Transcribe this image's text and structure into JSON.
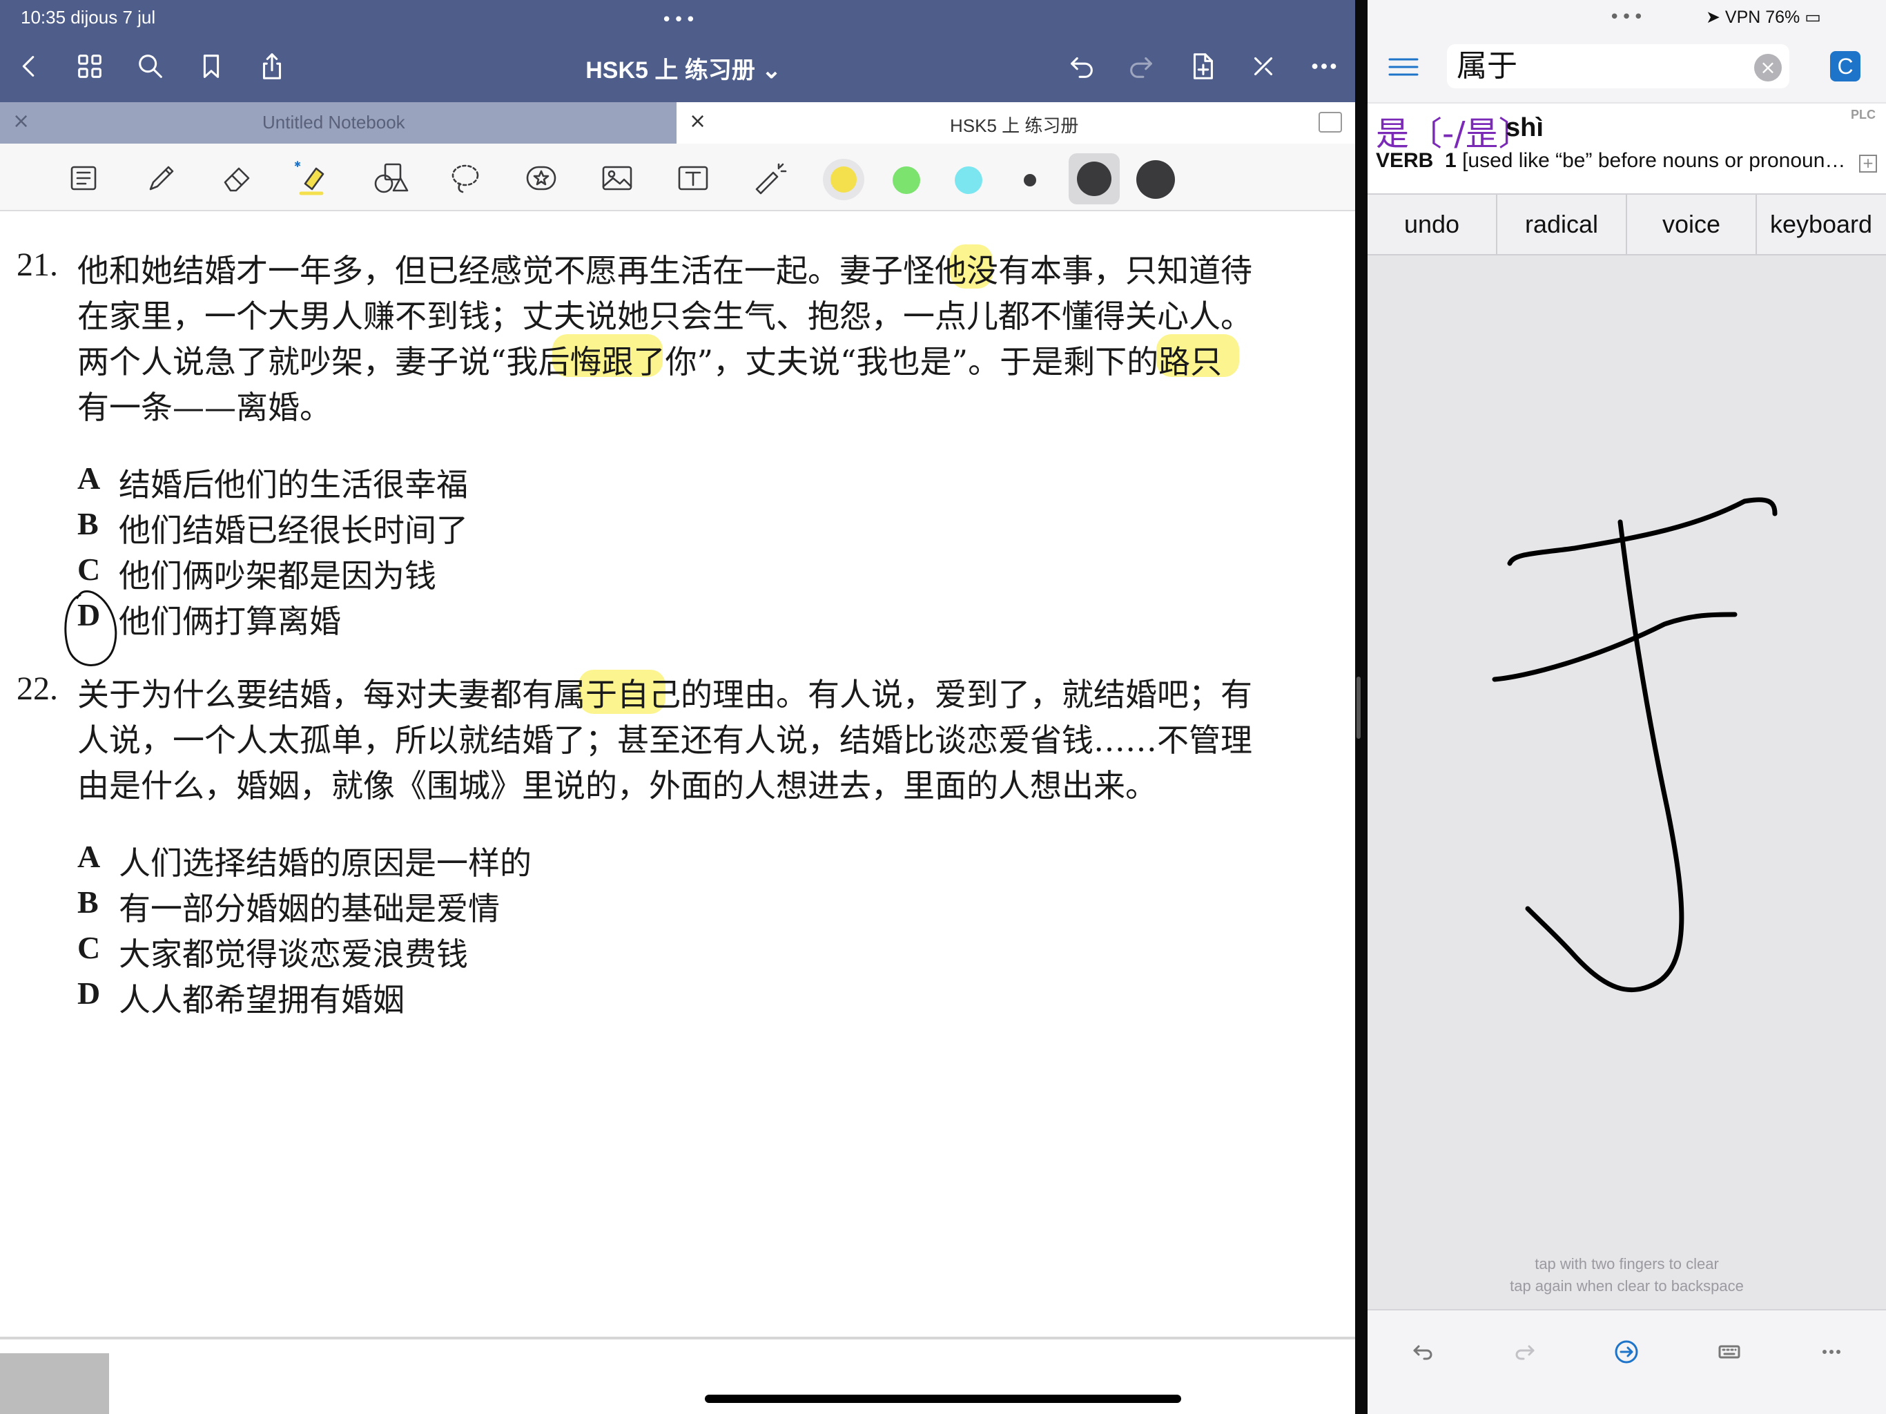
{
  "left_app": {
    "status": {
      "time_date": "10:35  dijous 7 jul"
    },
    "nav": {
      "doc_title": "HSK5 上 练习册 ⌄"
    },
    "tabs": [
      {
        "label": "Untitled Notebook"
      },
      {
        "label": "HSK5 上 练习册"
      }
    ],
    "colors": {
      "bar": "#4e5d8a",
      "highlight": "#fbf26a",
      "swatch_yellow": "#f4e04d",
      "swatch_green": "#7be36e",
      "swatch_cyan": "#7ce6f0",
      "ink": "#3a3a3c"
    },
    "toolbar_icons": [
      "pages-icon",
      "pen-icon",
      "eraser-icon",
      "highlighter-icon",
      "shapes-icon",
      "lasso-icon",
      "sticker-icon",
      "image-icon",
      "text-icon",
      "laser-pointer-icon"
    ],
    "questions": [
      {
        "number": "21.",
        "lines": [
          "他和她结婚才一年多，但已经感觉不愿再生活在一起。妻子怪他没有本事，只知道待",
          "在家里，一个大男人赚不到钱；丈夫说她只会生气、抱怨，一点儿都不懂得关心人。",
          "两个人说急了就吵架，妻子说“我后悔跟了你”，丈夫说“我也是”。于是剩下的路只",
          "有一条——离婚。"
        ],
        "options": [
          {
            "letter": "A",
            "text": "结婚后他们的生活很幸福"
          },
          {
            "letter": "B",
            "text": "他们结婚已经很长时间了"
          },
          {
            "letter": "C",
            "text": "他们俩吵架都是因为钱"
          },
          {
            "letter": "D",
            "text": "他们俩打算离婚"
          }
        ]
      },
      {
        "number": "22.",
        "lines": [
          "关于为什么要结婚，每对夫妻都有属于自己的理由。有人说，爱到了，就结婚吧；有",
          "人说，一个人太孤单，所以就结婚了；甚至还有人说，结婚比谈恋爱省钱……不管理",
          "由是什么，婚姻，就像《围城》里说的，外面的人想进去，里面的人想出来。"
        ],
        "options": [
          {
            "letter": "A",
            "text": "人们选择结婚的原因是一样的"
          },
          {
            "letter": "B",
            "text": "有一部分婚姻的基础是爱情"
          },
          {
            "letter": "C",
            "text": "大家都觉得谈恋爱浪费钱"
          },
          {
            "letter": "D",
            "text": "人人都希望拥有婚姻"
          }
        ]
      }
    ]
  },
  "right_app": {
    "status": {
      "right": "➤  VPN 76% ▭"
    },
    "search": {
      "value": "属于",
      "button": "C"
    },
    "result": {
      "hanzi": "是〔-/昰〕",
      "pinyin": "shì",
      "badge": "PLC",
      "pos": "VERB",
      "sense": "1",
      "definition": "[used like “be” before nouns or pronoun…"
    },
    "buttons": [
      "undo",
      "radical",
      "voice",
      "keyboard"
    ],
    "hints": [
      "tap with two fingers to clear",
      "tap again when clear to backspace"
    ],
    "accent": "#1d74c9",
    "hanzi_color": "#7b2ab8"
  }
}
